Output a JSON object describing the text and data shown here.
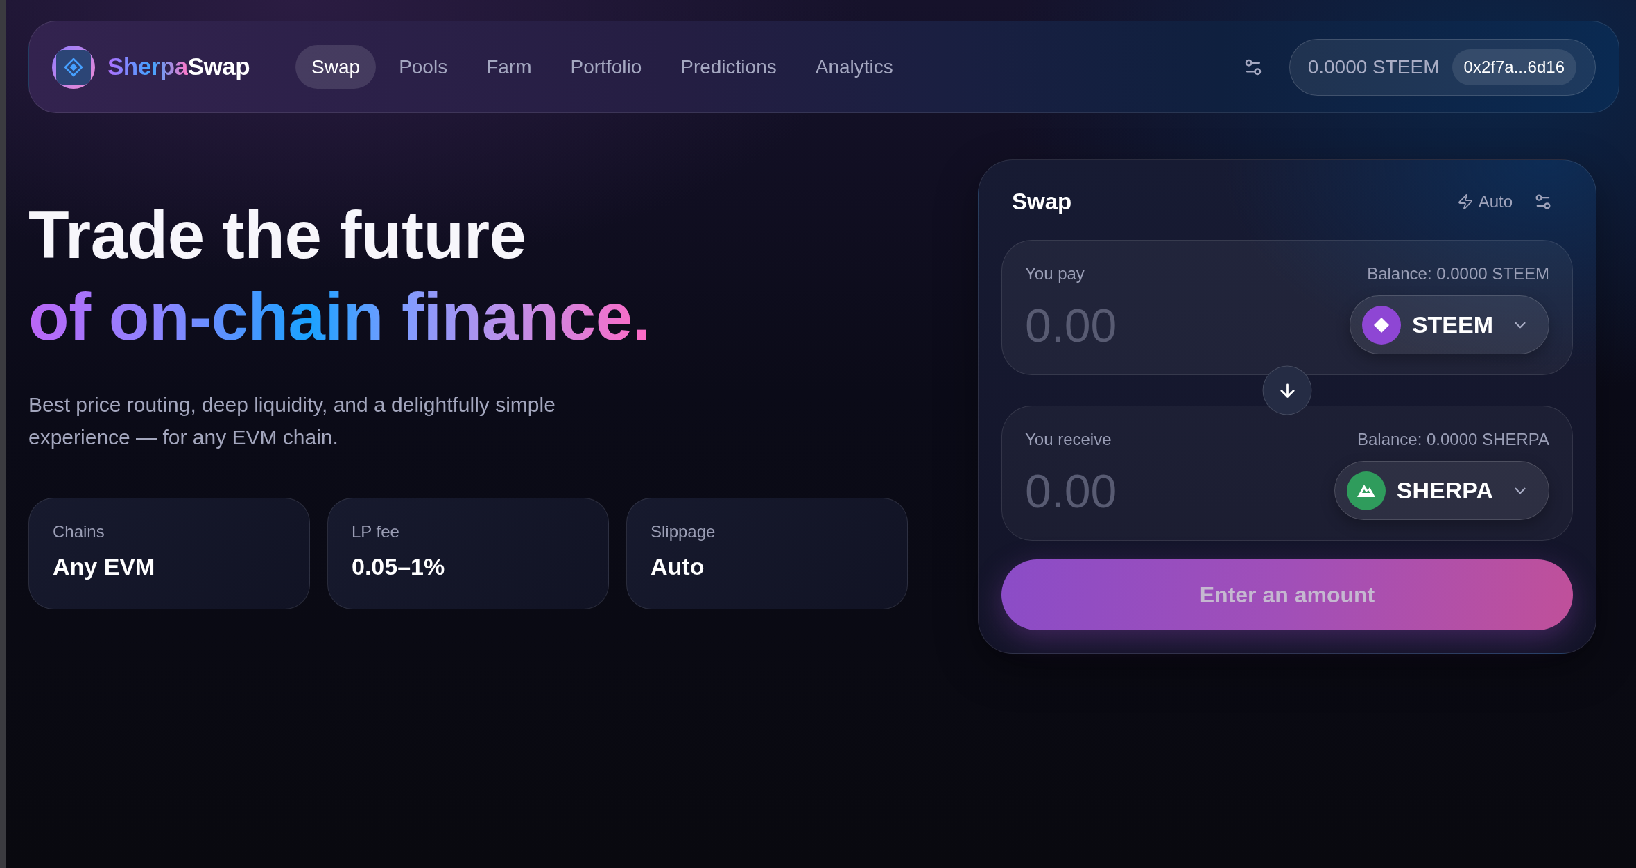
{
  "nav": {
    "brand": {
      "name_accent": "Sherpa",
      "name_rest": "Swap"
    },
    "items": [
      {
        "label": "Swap",
        "selected": true
      },
      {
        "label": "Pools",
        "selected": false
      },
      {
        "label": "Farm",
        "selected": false
      },
      {
        "label": "Portfolio",
        "selected": false
      },
      {
        "label": "Predictions",
        "selected": false
      },
      {
        "label": "Analytics",
        "selected": false
      }
    ],
    "wallet": {
      "balance": "0.0000 STEEM",
      "address": "0x2f7a...6d16"
    }
  },
  "hero": {
    "title": "Trade the future",
    "title_highlight": "of on-chain finance.",
    "subtitle": "Best price routing, deep liquidity, and a delightfully simple experience — for any EVM chain."
  },
  "stats": [
    {
      "label": "Chains",
      "value": "Any EVM"
    },
    {
      "label": "LP fee",
      "value": "0.05–1%"
    },
    {
      "label": "Slippage",
      "value": "Auto"
    }
  ],
  "swap": {
    "title": "Swap",
    "mode": "Auto",
    "panels": [
      {
        "label": "You pay",
        "balance": "Balance: 0.0000 STEEM",
        "placeholder": "0.00",
        "token": {
          "symbol": "STEEM",
          "color": "#8e46d4"
        }
      },
      {
        "label": "You receive",
        "balance": "Balance: 0.0000 SHERPA",
        "placeholder": "0.00",
        "token": {
          "symbol": "SHERPA",
          "color": "#2f9c5c"
        }
      }
    ],
    "submit": {
      "label": "Enter an amount",
      "disabled": true
    }
  }
}
